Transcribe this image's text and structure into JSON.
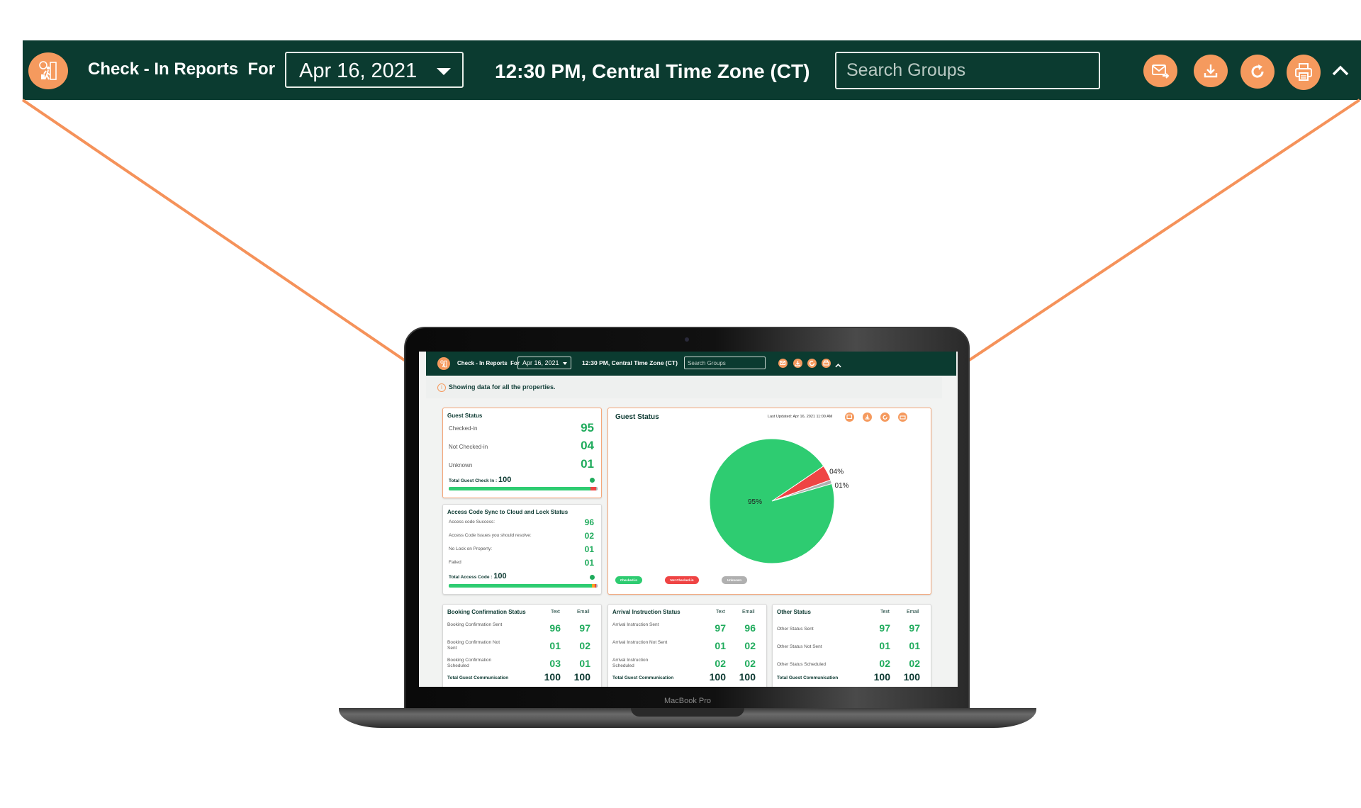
{
  "header": {
    "title": "Check - In Reports",
    "for_label": "For",
    "date_value": "Apr 16, 2021",
    "time_zone": "12:30 PM, Central Time Zone (CT)",
    "search_placeholder": "Search Groups",
    "actions": [
      {
        "icon": "email-forward-icon"
      },
      {
        "icon": "download-icon"
      },
      {
        "icon": "refresh-icon"
      },
      {
        "icon": "print-icon"
      }
    ],
    "collapse_icon": "chevron-up-icon"
  },
  "device_label": "MacBook Pro",
  "info_bar": {
    "text": "Showing data for all the properties."
  },
  "guest_status": {
    "title": "Guest Status",
    "rows": [
      {
        "label": "Checked-in",
        "value": "95"
      },
      {
        "label": "Not Checked-in",
        "value": "04"
      },
      {
        "label": "Unknown",
        "value": "01"
      }
    ],
    "total_label": "Total Guest Check In :",
    "total_value": "100",
    "progress": {
      "checked_in": 95,
      "not_checked_in": 4,
      "unknown": 1
    }
  },
  "access_code": {
    "title": "Access Code Sync to Cloud and Lock Status",
    "rows": [
      {
        "label": "Access code Success:",
        "value": "96"
      },
      {
        "label": "Access Code Issues you should resolve:",
        "value": "02"
      },
      {
        "label": "No Lock on Property:",
        "value": "01"
      },
      {
        "label": "Failed",
        "value": "01"
      }
    ],
    "total_label": "Total Access Code :",
    "total_value": "100",
    "progress": {
      "success": 96,
      "issues": 2,
      "no_lock": 1,
      "failed": 1
    }
  },
  "pie_panel": {
    "title": "Guest Status",
    "last_updated": "Last Updated: Apr 16, 2021 11:00 AM"
  },
  "chart_data": {
    "type": "pie",
    "title": "Guest Status",
    "slices": [
      {
        "label": "Checked-in",
        "value": 95,
        "display": "95%",
        "color": "#2ecc71"
      },
      {
        "label": "Not Checked-in",
        "value": 4,
        "display": "04%",
        "color": "#ef4444"
      },
      {
        "label": "Unknown",
        "value": 1,
        "display": "01%",
        "color": "#b0b0b0"
      }
    ],
    "legend": [
      "Checked-in",
      "Not Checked-in",
      "Unknown"
    ],
    "legend_position": "bottom-left"
  },
  "comm_cards": [
    {
      "title": "Booking Confirmation Status",
      "col_text": "Text",
      "col_email": "Email",
      "rows": [
        {
          "label": "Booking Confirmation Sent",
          "text": "96",
          "email": "97"
        },
        {
          "label": "Booking Confirmation Not Sent",
          "text": "01",
          "email": "02"
        },
        {
          "label": "Booking Confirmation Scheduled",
          "text": "03",
          "email": "01"
        }
      ],
      "total_label": "Total Guest Communication",
      "total_text": "100",
      "total_email": "100"
    },
    {
      "title": "Arrival Instruction Status",
      "col_text": "Text",
      "col_email": "Email",
      "rows": [
        {
          "label": "Arrival Instruction Sent",
          "text": "97",
          "email": "96"
        },
        {
          "label": "Arrival Instruction Not Sent",
          "text": "01",
          "email": "02"
        },
        {
          "label": "Arrival Instruction Scheduled",
          "text": "02",
          "email": "02"
        }
      ],
      "total_label": "Total Guest Communication",
      "total_text": "100",
      "total_email": "100"
    },
    {
      "title": "Other Status",
      "col_text": "Text",
      "col_email": "Email",
      "rows": [
        {
          "label": "Other Status Sent",
          "text": "97",
          "email": "97"
        },
        {
          "label": "Other Status Not Sent",
          "text": "01",
          "email": "01"
        },
        {
          "label": "Other Status Scheduled",
          "text": "02",
          "email": "02"
        }
      ],
      "total_label": "Total Guest Communication",
      "total_text": "100",
      "total_email": "100"
    }
  ],
  "colors": {
    "header_bg": "#0b3b30",
    "accent_orange": "#f59a5e",
    "value_green": "#1fab5c",
    "pie_green": "#2ecc71",
    "pie_red": "#ef4444",
    "pie_gray": "#b0b0b0"
  }
}
